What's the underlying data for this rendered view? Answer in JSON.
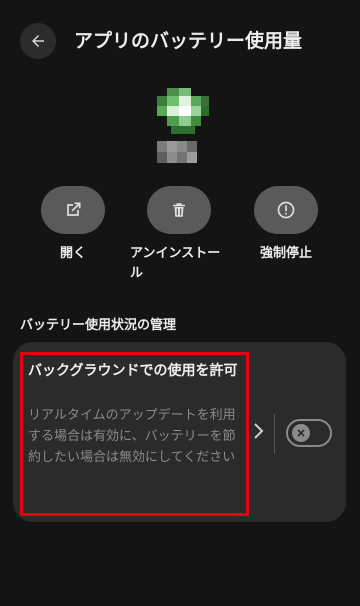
{
  "header": {
    "back_icon": "back-arrow-icon",
    "title": "アプリのバッテリー使用量"
  },
  "app": {
    "icon": "app-icon-pixelated",
    "name_blur": "app-name-pixelated"
  },
  "actions": [
    {
      "label": "開く",
      "icon": "open-external-icon"
    },
    {
      "label": "アンインストール",
      "icon": "trash-icon"
    },
    {
      "label": "強制停止",
      "icon": "force-stop-icon"
    }
  ],
  "section": {
    "title": "バッテリー使用状況の管理"
  },
  "background_setting": {
    "title": "バックグラウンドでの使用を許可",
    "description": "リアルタイムのアップデートを利用する場合は有効に、バッテリーを節約したい場合は無効にしてください",
    "chevron_icon": "chevron-right-icon",
    "toggle_on": false,
    "toggle_icon": "close-icon"
  },
  "colors": {
    "background": "#141414",
    "card": "#2b2b2b",
    "action_button": "#5a5a5a",
    "highlight": "#e60012",
    "muted_text": "#8a8a8a"
  }
}
